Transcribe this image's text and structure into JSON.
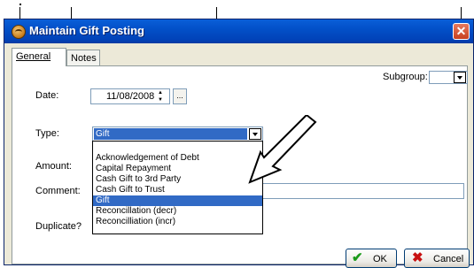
{
  "window": {
    "title": "Maintain Gift Posting",
    "close_glyph": "✕"
  },
  "tabs": [
    {
      "label": "General",
      "active": true
    },
    {
      "label": "Notes",
      "active": false
    }
  ],
  "form": {
    "subgroup_label": "Subgroup:",
    "date_label": "Date:",
    "date_value": "11/08/2008",
    "ellipsis": "...",
    "type_label": "Type:",
    "type_value": "Gift",
    "amount_label": "Amount:",
    "comment_label": "Comment:",
    "duplicate_label": "Duplicate?"
  },
  "type_options": [
    "",
    "Acknowledgement of Debt",
    "Capital Repayment",
    "Cash Gift to 3rd Party",
    "Cash Gift to Trust",
    "Gift",
    "Reconcillation (decr)",
    "Reconcilliation (incr)"
  ],
  "selected_option_index": 5,
  "buttons": {
    "ok": "OK",
    "cancel": "Cancel"
  },
  "colors": {
    "titlebar": "#0250c8",
    "selection": "#316ac5",
    "ok_icon": "#1a9a1a",
    "cancel_icon": "#c81010"
  }
}
